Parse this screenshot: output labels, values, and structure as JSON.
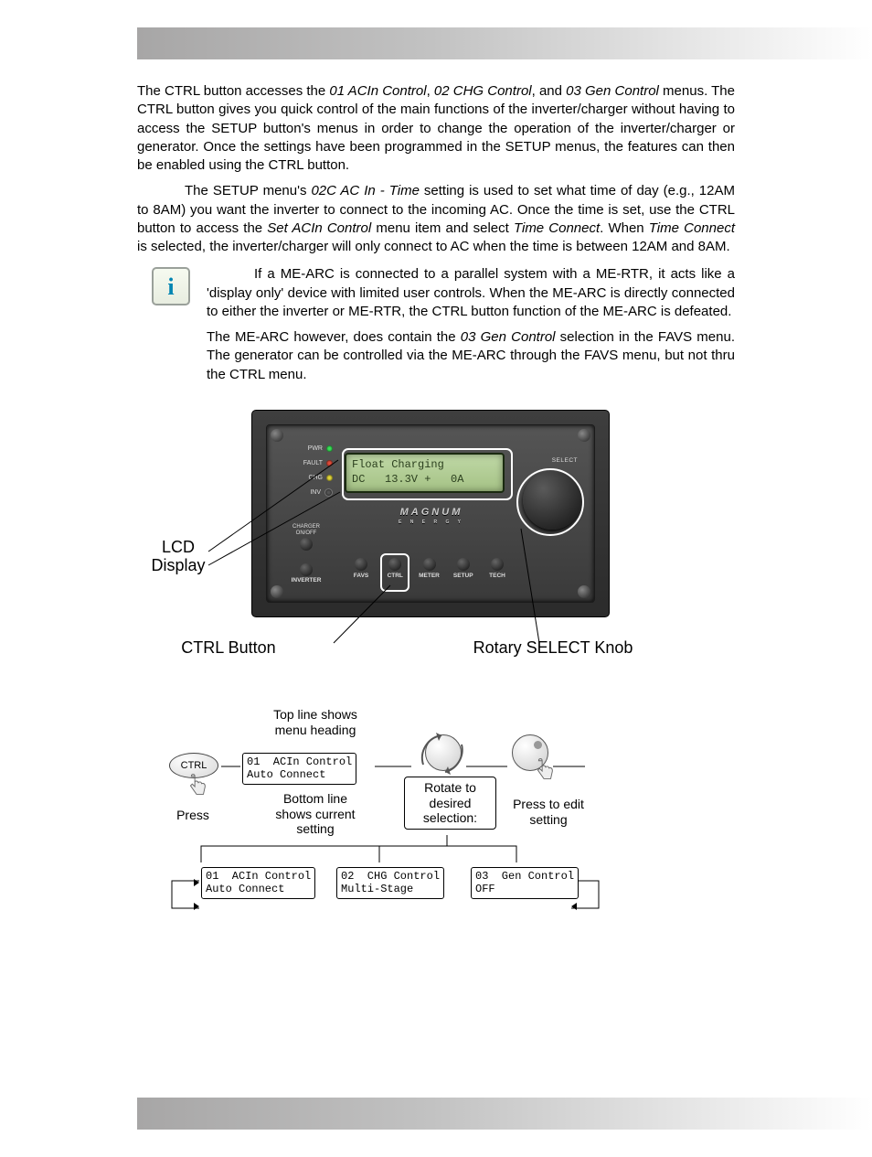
{
  "body": {
    "p1_a": "The CTRL button accesses the ",
    "p1_i1": "01 ACIn Control",
    "p1_b": ", ",
    "p1_i2": "02 CHG Control",
    "p1_c": ", and ",
    "p1_i3": "03 Gen Control",
    "p1_d": " menus. The CTRL button gives you quick control of the main functions of the inverter/charger without having to access the SETUP button's menus in order to change the operation of the inverter/charger or generator. Once the settings have been programmed in the SETUP menus, the features can then be enabled using the CTRL button.",
    "p2_a": "The SETUP menu's ",
    "p2_i1": "02C AC In - Time",
    "p2_b": " setting is used to set what time of day (e.g., 12AM to 8AM) you want the inverter to connect to the incoming AC. Once the time is set, use the CTRL button to access the ",
    "p2_i2": "Set ACIn Control",
    "p2_c": " menu item and select ",
    "p2_i3": "Time Connect",
    "p2_d": ". When ",
    "p2_i4": "Time Connect",
    "p2_e": " is selected, the inverter/charger will only connect to AC when the time is between 12AM and 8AM.",
    "note1": "If a ME-ARC is connected to a parallel system with a ME-RTR, it acts like a 'display only' device with limited user controls. When the ME-ARC is directly connected to either the inverter or ME-RTR, the CTRL button function of the ME-ARC is defeated.",
    "note2_a": "The ME-ARC however, does contain the ",
    "note2_i": "03 Gen Control",
    "note2_b": " selection in the FAVS menu. The generator can be controlled via the ME-ARC through the FAVS menu, but not thru the CTRL menu."
  },
  "device": {
    "leds": {
      "pwr": "PWR",
      "fault": "FAULT",
      "chg": "CHG",
      "inv": "INV"
    },
    "lcd_line1": "Float Charging",
    "lcd_line2": "DC   13.3V +   0A",
    "select": "SELECT",
    "brand": "MAGNUM",
    "brand_sub": "E N E R G Y",
    "charger": "CHARGER",
    "onoff": "ON/OFF",
    "inverter": "INVERTER",
    "menu": {
      "favs": "FAVS",
      "ctrl": "CTRL",
      "meter": "METER",
      "setup": "SETUP",
      "tech": "TECH"
    }
  },
  "callouts": {
    "lcd": "LCD\nDisplay",
    "ctrl": "CTRL Button",
    "knob": "Rotary SELECT Knob"
  },
  "flow": {
    "ctrl": "CTRL",
    "press": "Press",
    "topline": "Top line shows\nmenu heading",
    "botline": "Bottom line\nshows current\nsetting",
    "rotate": "Rotate to\ndesired\nselection:",
    "pressedit": "Press to edit\nsetting",
    "scr_main": "01  ACIn Control\nAuto Connect",
    "scr1": "01  ACIn Control\nAuto Connect",
    "scr2": "02  CHG Control\nMulti-Stage",
    "scr3": "03  Gen Control\nOFF"
  }
}
